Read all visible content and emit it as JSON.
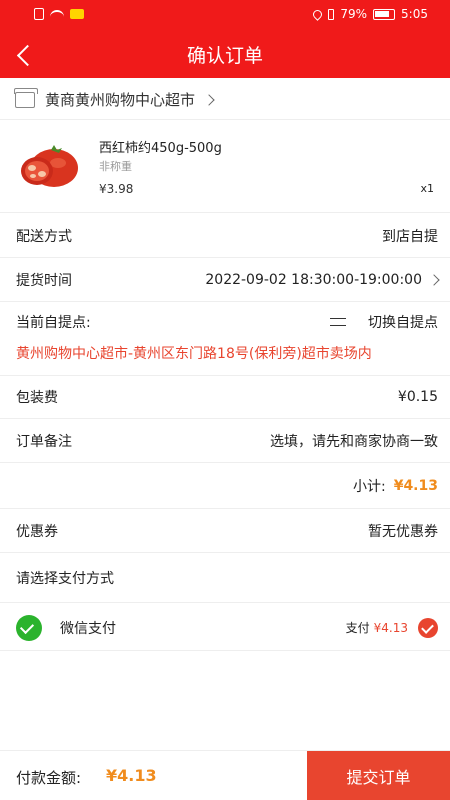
{
  "status_bar": {
    "battery": "79%",
    "time": "5:05"
  },
  "header": {
    "title": "确认订单"
  },
  "store": {
    "name": "黄商黄州购物中心超市"
  },
  "product": {
    "name": "西红柿约450g-500g",
    "spec": "非称重",
    "price": "¥3.98",
    "qty": "x1"
  },
  "delivery": {
    "label": "配送方式",
    "value": "到店自提"
  },
  "pickup_time": {
    "label": "提货时间",
    "value": "2022-09-02 18:30:00-19:00:00"
  },
  "pickup_point": {
    "label": "当前自提点:",
    "switch_label": "切换自提点",
    "address": "黄州购物中心超市-黄州区东门路18号(保利旁)超市卖场内"
  },
  "packaging": {
    "label": "包装费",
    "value": "¥0.15"
  },
  "remark": {
    "label": "订单备注",
    "placeholder": "选填，请先和商家协商一致"
  },
  "subtotal": {
    "label": "小计:",
    "value": "¥4.13"
  },
  "coupon": {
    "label": "优惠券",
    "value": "暂无优惠券"
  },
  "payment": {
    "section_label": "请选择支付方式",
    "method": "微信支付",
    "pay_label": "支付",
    "pay_amount": "¥4.13"
  },
  "footer": {
    "total_label": "付款金额:",
    "total_value": "¥4.13",
    "submit_label": "提交订单"
  },
  "colors": {
    "brand_red": "#f01a1a",
    "accent_red": "#e8452f",
    "price_orange": "#f08c1e",
    "wechat_green": "#2bb32d"
  }
}
